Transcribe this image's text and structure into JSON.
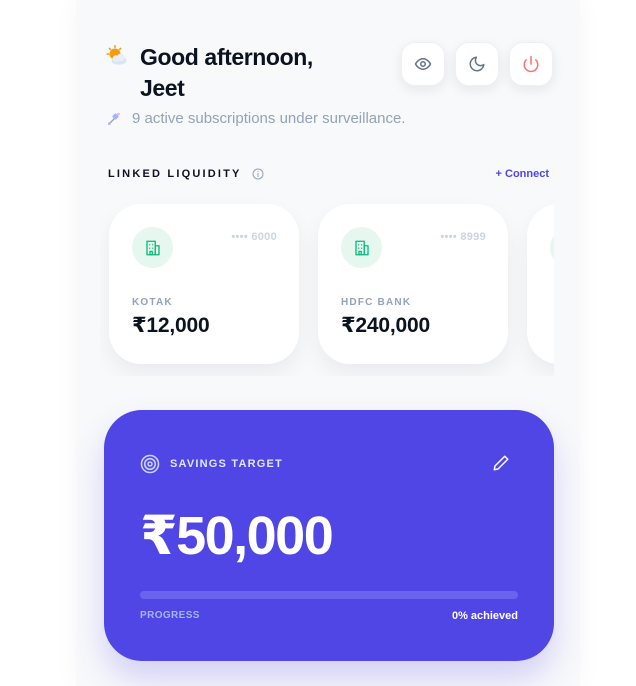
{
  "header": {
    "greeting": "Good afternoon,",
    "name": "Jeet",
    "subtitle": "9 active subscriptions under surveillance.",
    "greeting_icon": "sun-behind-cloud-icon",
    "subtitle_icon": "satellite-icon"
  },
  "actions": [
    {
      "icon": "eye-icon",
      "color": "#64748b"
    },
    {
      "icon": "moon-icon",
      "color": "#64748b"
    },
    {
      "icon": "power-icon",
      "color": "#f87171"
    }
  ],
  "linked": {
    "title": "LINKED LIQUIDITY",
    "connect_label": "+ Connect",
    "accounts": [
      {
        "name": "KOTAK",
        "mask": "•••• 6000",
        "balance": "₹12,000",
        "icon": "bank-building-icon"
      },
      {
        "name": "HDFC BANK",
        "mask": "•••• 8999",
        "balance": "₹240,000",
        "icon": "bank-building-icon"
      }
    ]
  },
  "savings": {
    "title": "SAVINGS TARGET",
    "amount": "₹50,000",
    "progress_label": "PROGRESS",
    "achieved_label": "0% achieved",
    "progress": 0,
    "color": "#4f46e5"
  }
}
